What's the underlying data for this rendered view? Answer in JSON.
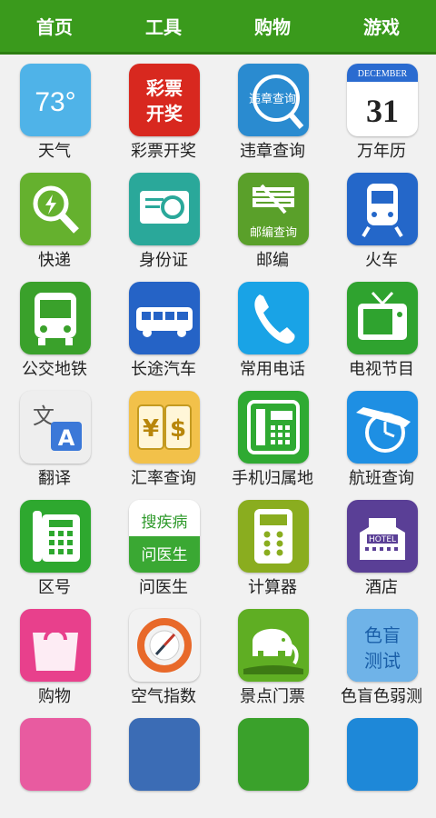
{
  "tabs": [
    "首页",
    "工具",
    "购物",
    "游戏"
  ],
  "apps": [
    {
      "label": "天气",
      "icon": "weather-icon",
      "color": "#4fb3e8",
      "text": "73°"
    },
    {
      "label": "彩票开奖",
      "icon": "lottery-icon",
      "color": "#d8281f",
      "text": "彩票开奖"
    },
    {
      "label": "违章查询",
      "icon": "traffic-violation-icon",
      "color": "#2a8bd0",
      "text": "违章查询"
    },
    {
      "label": "万年历",
      "icon": "calendar-icon",
      "color": "#ffffff",
      "text": "DECEMBER",
      "text2": "31"
    },
    {
      "label": "快递",
      "icon": "express-search-icon",
      "color": "#65b12e"
    },
    {
      "label": "身份证",
      "icon": "id-card-icon",
      "color": "#2aa89a"
    },
    {
      "label": "邮编",
      "icon": "postcode-icon",
      "color": "#5aa02a",
      "text": "邮编查询"
    },
    {
      "label": "火车",
      "icon": "train-icon",
      "color": "#2467c9"
    },
    {
      "label": "公交地铁",
      "icon": "bus-icon",
      "color": "#3aa12b"
    },
    {
      "label": "长途汽车",
      "icon": "coach-icon",
      "color": "#2563c6"
    },
    {
      "label": "常用电话",
      "icon": "phone-icon",
      "color": "#19a3e6"
    },
    {
      "label": "电视节目",
      "icon": "tv-icon",
      "color": "#2fa32f"
    },
    {
      "label": "翻译",
      "icon": "translate-icon",
      "color": "#eeeeee",
      "text": "文",
      "text2": "A"
    },
    {
      "label": "汇率查询",
      "icon": "exchange-rate-icon",
      "color": "#f2c14a",
      "text": "¥",
      "text2": "$"
    },
    {
      "label": "手机归属地",
      "icon": "landline-phone-icon",
      "color": "#2faa32"
    },
    {
      "label": "航班查询",
      "icon": "flight-icon",
      "color": "#1e8fe3"
    },
    {
      "label": "区号",
      "icon": "desk-phone-icon",
      "color": "#2ea82f"
    },
    {
      "label": "问医生",
      "icon": "doctor-icon",
      "color": "#ffffff",
      "text": "搜疾病",
      "text2": "问医生"
    },
    {
      "label": "计算器",
      "icon": "calculator-icon",
      "color": "#8aad1f"
    },
    {
      "label": "酒店",
      "icon": "hotel-icon",
      "color": "#5a3f96",
      "text": "HOTEL"
    },
    {
      "label": "购物",
      "icon": "shopping-bag-icon",
      "color": "#e8408c"
    },
    {
      "label": "空气指数",
      "icon": "air-index-icon",
      "color": "#f2f2f2"
    },
    {
      "label": "景点门票",
      "icon": "elephant-icon",
      "color": "#5fae23"
    },
    {
      "label": "色盲色弱测",
      "icon": "color-test-icon",
      "color": "#2a8fd8",
      "text": "色盲测试"
    },
    {
      "label": "",
      "icon": "partial-icon",
      "color": "#e85ba0"
    },
    {
      "label": "",
      "icon": "partial-icon",
      "color": "#3b6cb5"
    },
    {
      "label": "",
      "icon": "partial-icon",
      "color": "#3aa12b"
    },
    {
      "label": "",
      "icon": "partial-icon",
      "color": "#1e88d8"
    }
  ]
}
